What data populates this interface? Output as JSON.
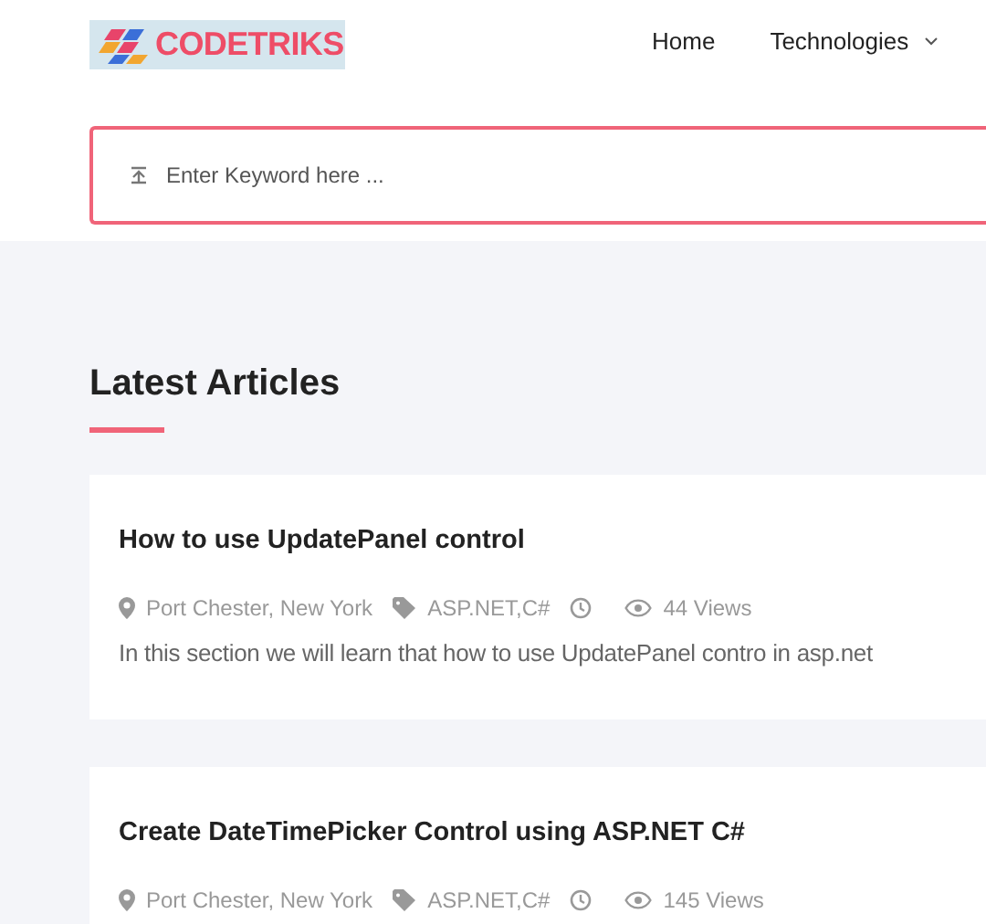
{
  "logo": {
    "text": "CODETRIKS"
  },
  "nav": [
    {
      "label": "Home",
      "has_dropdown": false
    },
    {
      "label": "Technologies",
      "has_dropdown": true
    }
  ],
  "search": {
    "placeholder": "Enter Keyword here ..."
  },
  "section_title": "Latest Articles",
  "articles": [
    {
      "title": "How to use UpdatePanel control",
      "location": "Port Chester, New York",
      "tags": "ASP.NET,C#",
      "views": "44 Views",
      "summary": "In this section we will learn that how to use UpdatePanel contro in asp.net"
    },
    {
      "title": "Create DateTimePicker Control using ASP.NET C#",
      "location": "Port Chester, New York",
      "tags": "ASP.NET,C#",
      "views": "145 Views"
    }
  ]
}
